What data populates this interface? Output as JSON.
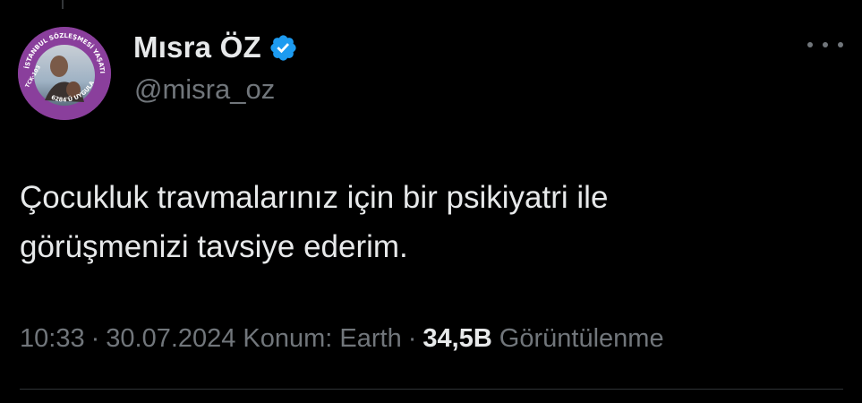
{
  "tweet": {
    "author": {
      "display_name": "Mısra ÖZ",
      "handle": "@misra_oz",
      "verified": true,
      "avatar_ring_text_top": "İSTANBUL SÖZLEŞMESİ YAŞATIR",
      "avatar_ring_text_left": "TCK-103",
      "avatar_ring_text_bottom": "6284'Ü UYGULA"
    },
    "text_lines": [
      "Çocukluk travmalarınız için bir psikiyatri ile",
      "görüşmenizi tavsiye ederim."
    ],
    "meta": {
      "time": "10:33",
      "separator": "·",
      "date": "30.07.2024",
      "location": "Konum: Earth",
      "views_count": "34,5B",
      "views_label": "Görüntülenme"
    }
  },
  "icons": {
    "verified": "verified-badge-icon",
    "more": "more-horizontal-icon"
  },
  "colors": {
    "background": "#000000",
    "text_primary": "#e7e9ea",
    "text_secondary": "#71767b",
    "verified_blue": "#1d9bf0",
    "avatar_ring": "#8a3f9c",
    "divider": "#2f3336"
  }
}
